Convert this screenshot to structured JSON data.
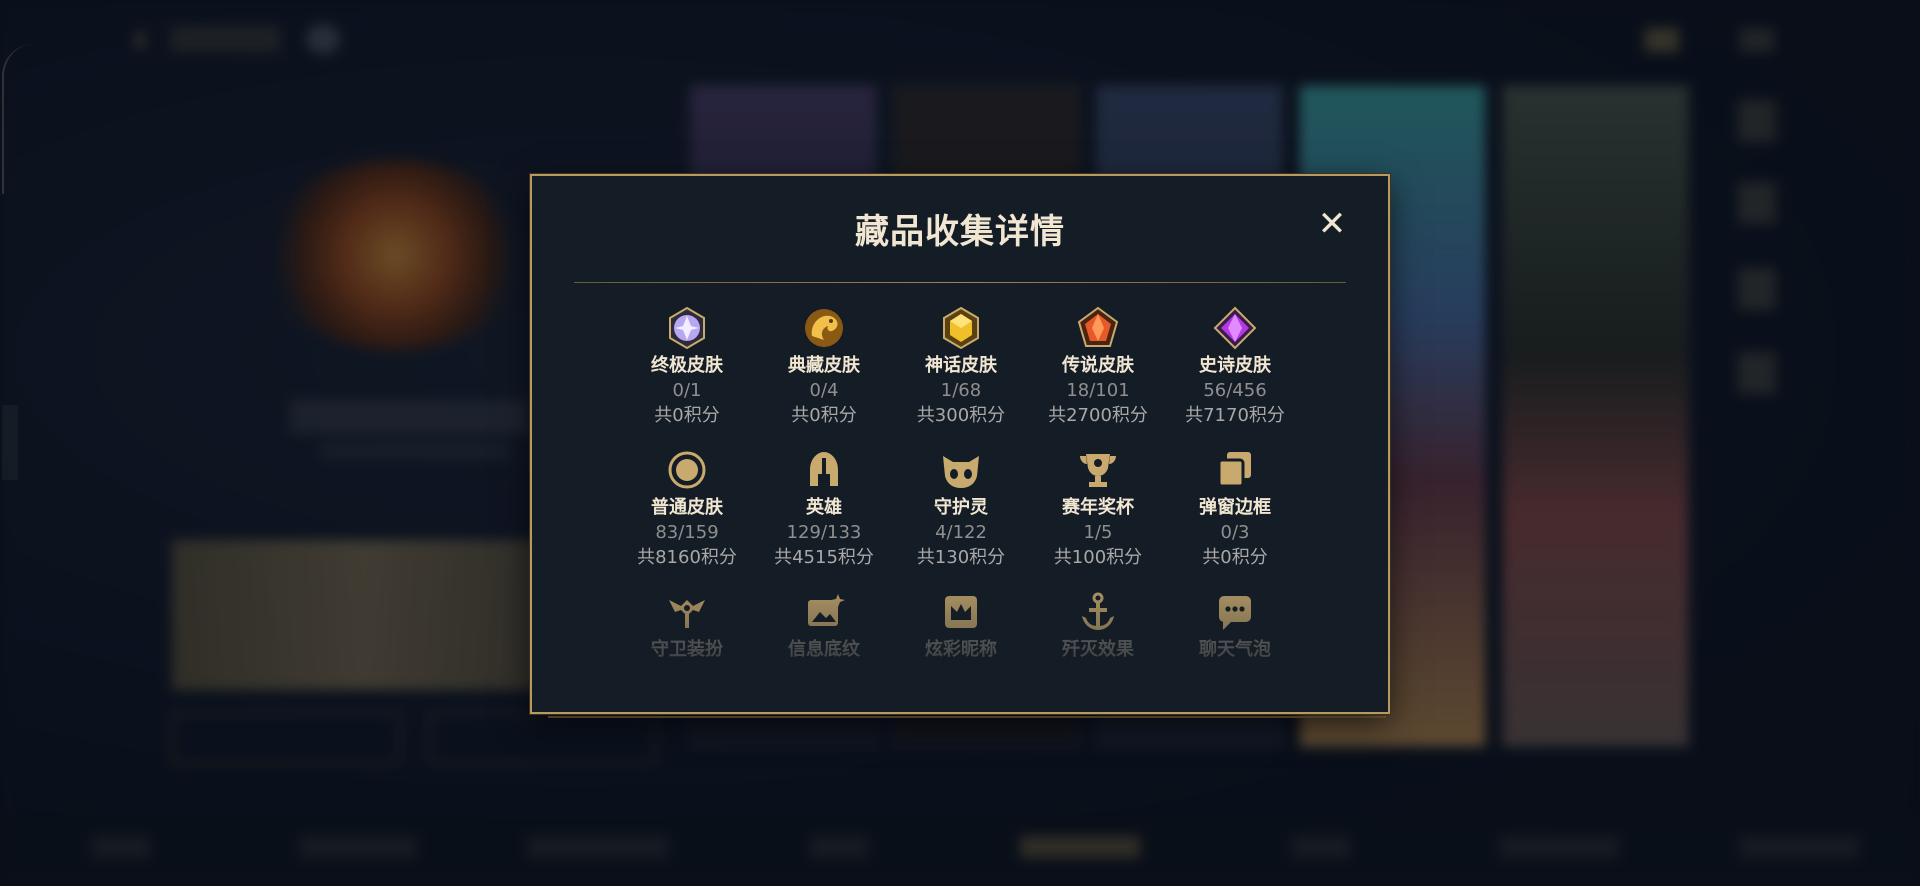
{
  "modal": {
    "title": "藏品收集详情",
    "close_label": "✕",
    "rows": [
      [
        {
          "name": "终极皮肤",
          "count": "0/1",
          "points": "共0积分",
          "icon": "ultimate-skin-gem-icon"
        },
        {
          "name": "典藏皮肤",
          "count": "0/4",
          "points": "共0积分",
          "icon": "prestige-skin-dragon-icon"
        },
        {
          "name": "神话皮肤",
          "count": "1/68",
          "points": "共300积分",
          "icon": "mythic-skin-gem-icon"
        },
        {
          "name": "传说皮肤",
          "count": "18/101",
          "points": "共2700积分",
          "icon": "legendary-skin-gem-icon"
        },
        {
          "name": "史诗皮肤",
          "count": "56/456",
          "points": "共7170积分",
          "icon": "epic-skin-gem-icon"
        }
      ],
      [
        {
          "name": "普通皮肤",
          "count": "83/159",
          "points": "共8160积分",
          "icon": "standard-skin-ring-icon"
        },
        {
          "name": "英雄",
          "count": "129/133",
          "points": "共4515积分",
          "icon": "champion-helmet-icon"
        },
        {
          "name": "守护灵",
          "count": "4/122",
          "points": "共130积分",
          "icon": "little-legend-icon"
        },
        {
          "name": "赛年奖杯",
          "count": "1/5",
          "points": "共100积分",
          "icon": "trophy-icon"
        },
        {
          "name": "弹窗边框",
          "count": "0/3",
          "points": "共0积分",
          "icon": "popup-frame-icon"
        }
      ],
      [
        {
          "name": "守卫装扮",
          "icon": "ward-skin-icon"
        },
        {
          "name": "信息底纹",
          "icon": "banner-icon"
        },
        {
          "name": "炫彩昵称",
          "icon": "crown-name-icon"
        },
        {
          "name": "歼灭效果",
          "icon": "finisher-anchor-icon"
        },
        {
          "name": "聊天气泡",
          "icon": "chat-bubble-icon"
        }
      ]
    ]
  },
  "colors": {
    "gold": "#c8aa6e",
    "title": "#f0e6d2",
    "panel": "#141c26",
    "ultimate": "#c9b6f5",
    "mythic": "#f0c02a",
    "legendary": "#e8592a",
    "epic": "#b23ae0"
  }
}
